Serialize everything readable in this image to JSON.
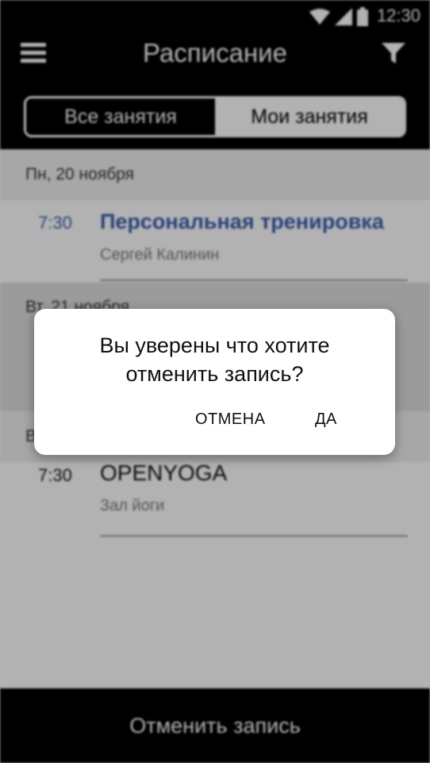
{
  "status_bar": {
    "time": "12:30",
    "icons": [
      "wifi-icon",
      "cell-signal-icon",
      "battery-icon"
    ]
  },
  "header": {
    "title": "Расписание",
    "tabs": {
      "all": "Все занятия",
      "mine": "Мои занятия",
      "selected": "mine"
    }
  },
  "schedule": {
    "days": [
      {
        "label": "Пн, 20 ноября",
        "items": [
          {
            "time": "7:30",
            "title": "Персональная тренировка",
            "subtitle": "Сергей Калинин",
            "accent": true
          }
        ]
      },
      {
        "label": "Вт, 21 ноября"
      },
      {
        "label": "Вт",
        "items": [
          {
            "time": "7:30",
            "title": "OPENYOGA",
            "subtitle": "Зал йоги",
            "accent": false
          }
        ]
      }
    ]
  },
  "bottom_button": {
    "label": "Отменить запись"
  },
  "dialog": {
    "message_line1": "Вы уверены что хотите",
    "message_line2": "отменить запись?",
    "cancel_label": "ОТМЕНА",
    "confirm_label": "ДА"
  },
  "colors": {
    "accent": "#3b5fb0",
    "header_bg": "#000000",
    "muted_text": "#7a7a7a",
    "scrim": "rgba(0,0,0,0.30)"
  }
}
